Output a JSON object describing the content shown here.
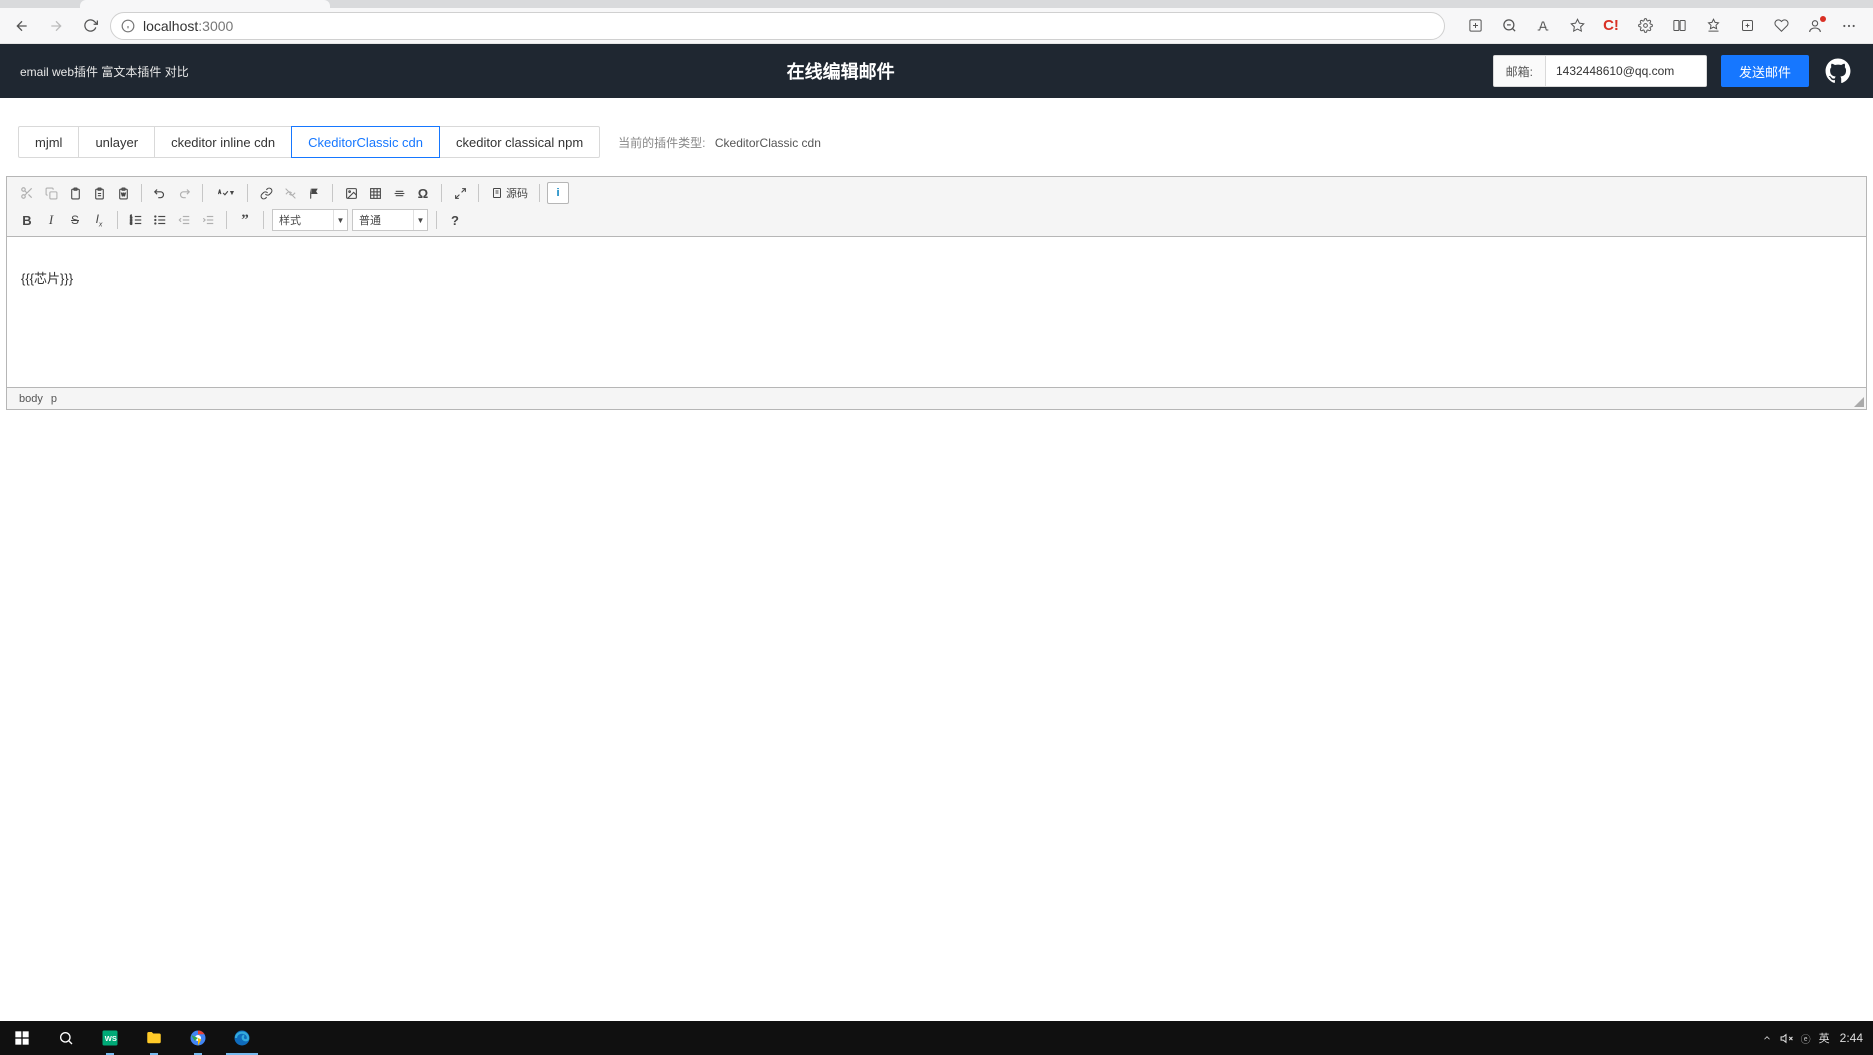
{
  "browser": {
    "url_host": "localhost",
    "url_port": ":3000"
  },
  "app_header": {
    "left_text": "email web插件 富文本插件 对比",
    "title": "在线编辑邮件",
    "email_label": "邮箱:",
    "email_value": "1432448610@qq.com",
    "send_label": "发送邮件"
  },
  "plugin_tabs": {
    "options": [
      "mjml",
      "unlayer",
      "ckeditor inline cdn",
      "CkeditorClassic cdn",
      "ckeditor classical npm"
    ],
    "active_index": 3,
    "current_label": "当前的插件类型:",
    "current_value": "CkeditorClassic cdn"
  },
  "ckeditor": {
    "combo_style": "样式",
    "combo_format": "普通",
    "source_label": "源码",
    "content_text": "{{{芯片}}}",
    "path": [
      "body",
      "p"
    ]
  },
  "taskbar": {
    "ime": "英",
    "clock": "2:44"
  }
}
